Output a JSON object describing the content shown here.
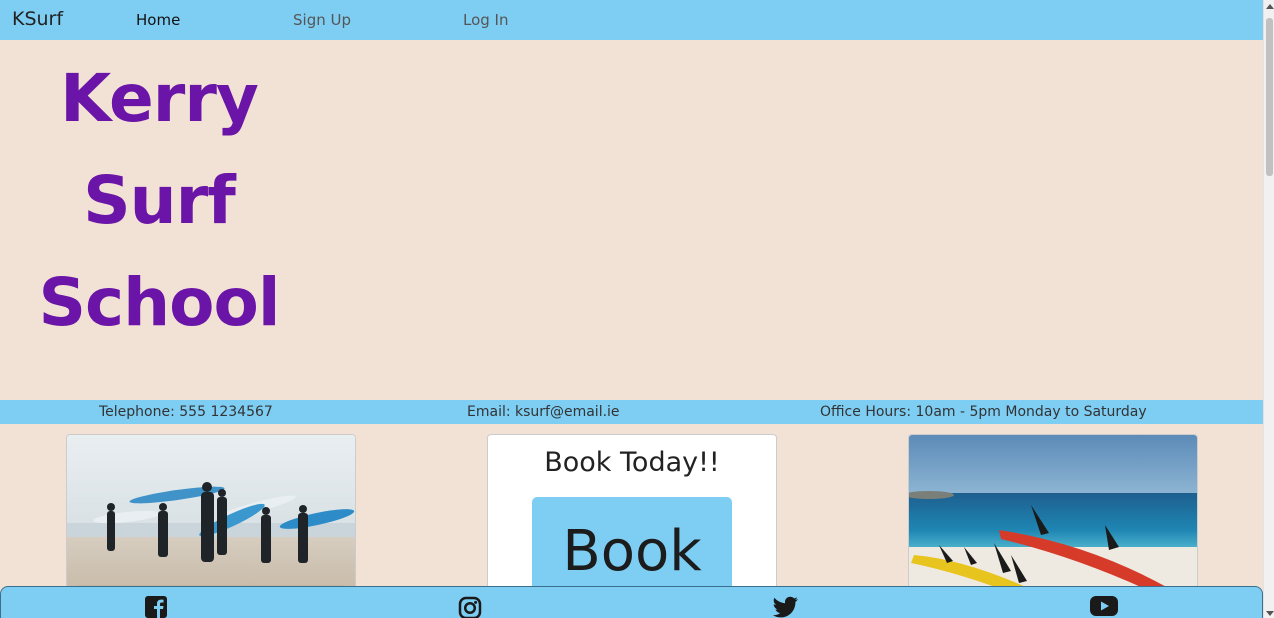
{
  "nav": {
    "brand": "KSurf",
    "links": [
      {
        "label": "Home",
        "active": true
      },
      {
        "label": "Sign Up",
        "active": false
      },
      {
        "label": "Log In",
        "active": false
      }
    ]
  },
  "hero": {
    "title_lines": [
      "Kerry",
      "Surf",
      "School"
    ],
    "title_color": "#6a14a8"
  },
  "contact": {
    "telephone": "Telephone: 555 1234567",
    "email": "Email: ksurf@email.ie",
    "hours": "Office Hours: 10am - 5pm Monday to Saturday"
  },
  "cards": {
    "left": {
      "image": "surfers-walking-photo"
    },
    "middle": {
      "title": "Book Today!!",
      "button_label": "Book"
    },
    "right": {
      "image": "surfboards-on-beach-photo"
    }
  },
  "footer": {
    "icons": [
      "facebook-icon",
      "instagram-icon",
      "twitter-icon",
      "youtube-icon"
    ]
  },
  "colors": {
    "accent": "#7ecef4",
    "background": "#f2e2d5",
    "title": "#6a14a8"
  }
}
